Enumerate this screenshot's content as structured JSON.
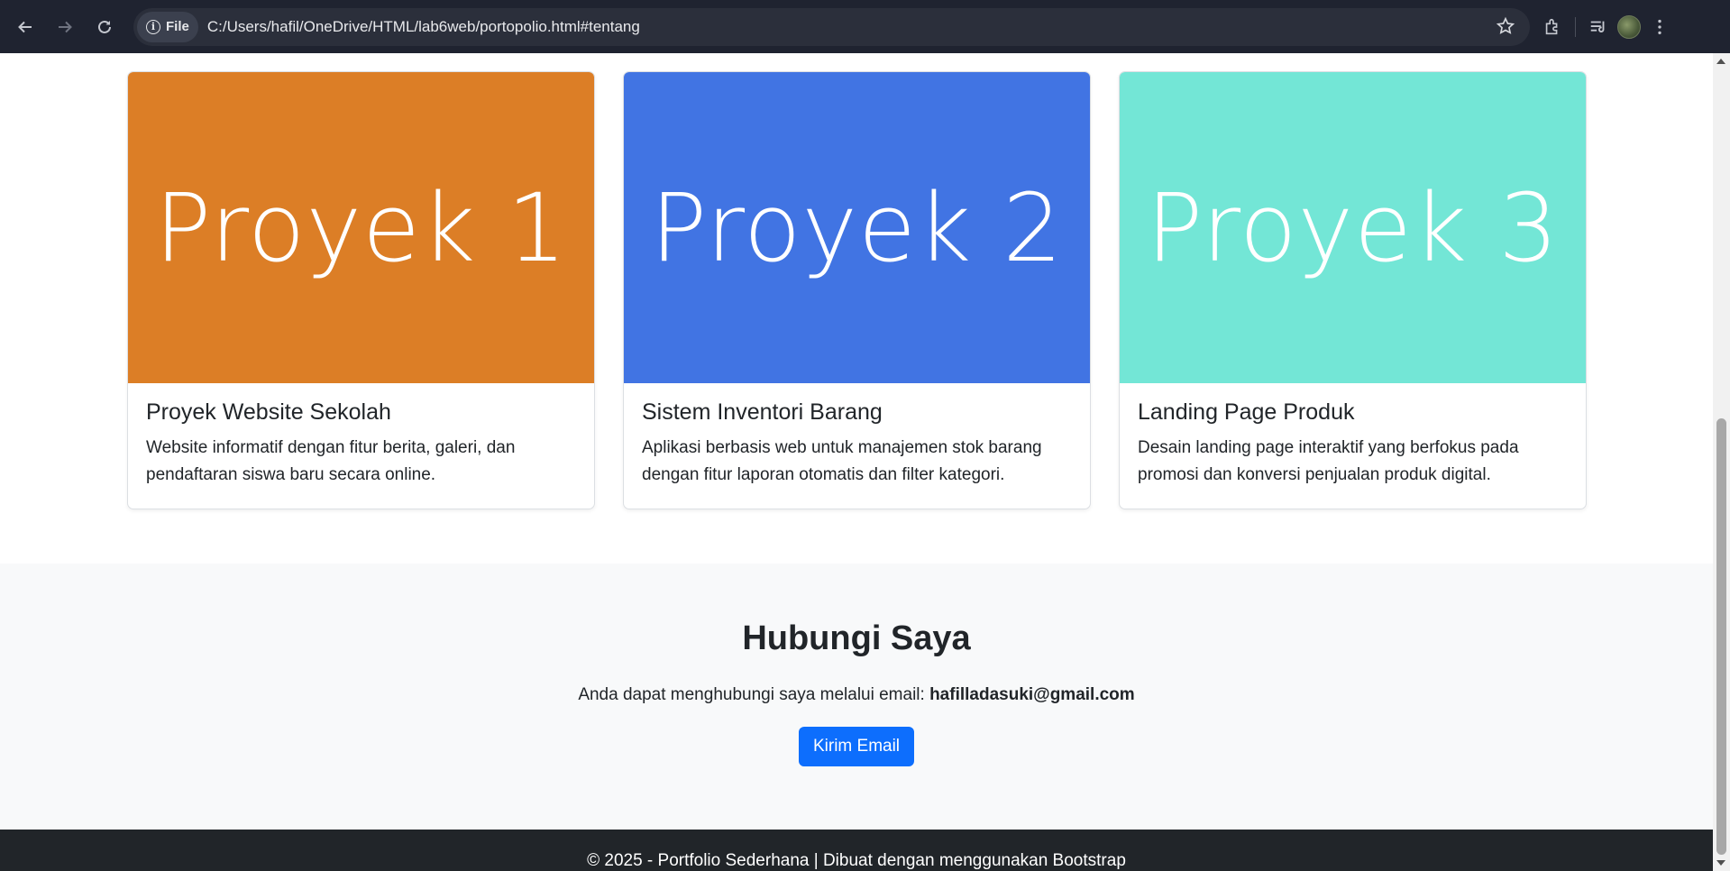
{
  "browser": {
    "chip_label": "File",
    "url": "C:/Users/hafil/OneDrive/HTML/lab6web/portopolio.html#tentang"
  },
  "projects": [
    {
      "image_text": "Proyek 1",
      "image_color": "#dc7e26",
      "title": "Proyek Website Sekolah",
      "description_line1": "Website informatif dengan fitur berita, galeri, dan",
      "description_line2": "pendaftaran siswa baru secara online."
    },
    {
      "image_text": "Proyek 2",
      "image_color": "#4174e3",
      "title": "Sistem Inventori Barang",
      "description_line1": "Aplikasi berbasis web untuk manajemen stok barang",
      "description_line2": "dengan fitur laporan otomatis dan filter kategori."
    },
    {
      "image_text": "Proyek 3",
      "image_color": "#73e6d6",
      "title": "Landing Page Produk",
      "description_line1": "Desain landing page interaktif yang berfokus pada",
      "description_line2": "promosi dan konversi penjualan produk digital."
    }
  ],
  "contact": {
    "heading": "Hubungi Saya",
    "text": "Anda dapat menghubungi saya melalui email:",
    "email": "hafilladasuki@gmail.com",
    "button_label": "Kirim Email"
  },
  "footer": {
    "text": "© 2025 - Portfolio Sederhana | Dibuat dengan menggunakan Bootstrap"
  },
  "colors": {
    "primary": "#0d6efd",
    "footer_bg": "#212529",
    "contact_bg": "#f8f9fa"
  }
}
